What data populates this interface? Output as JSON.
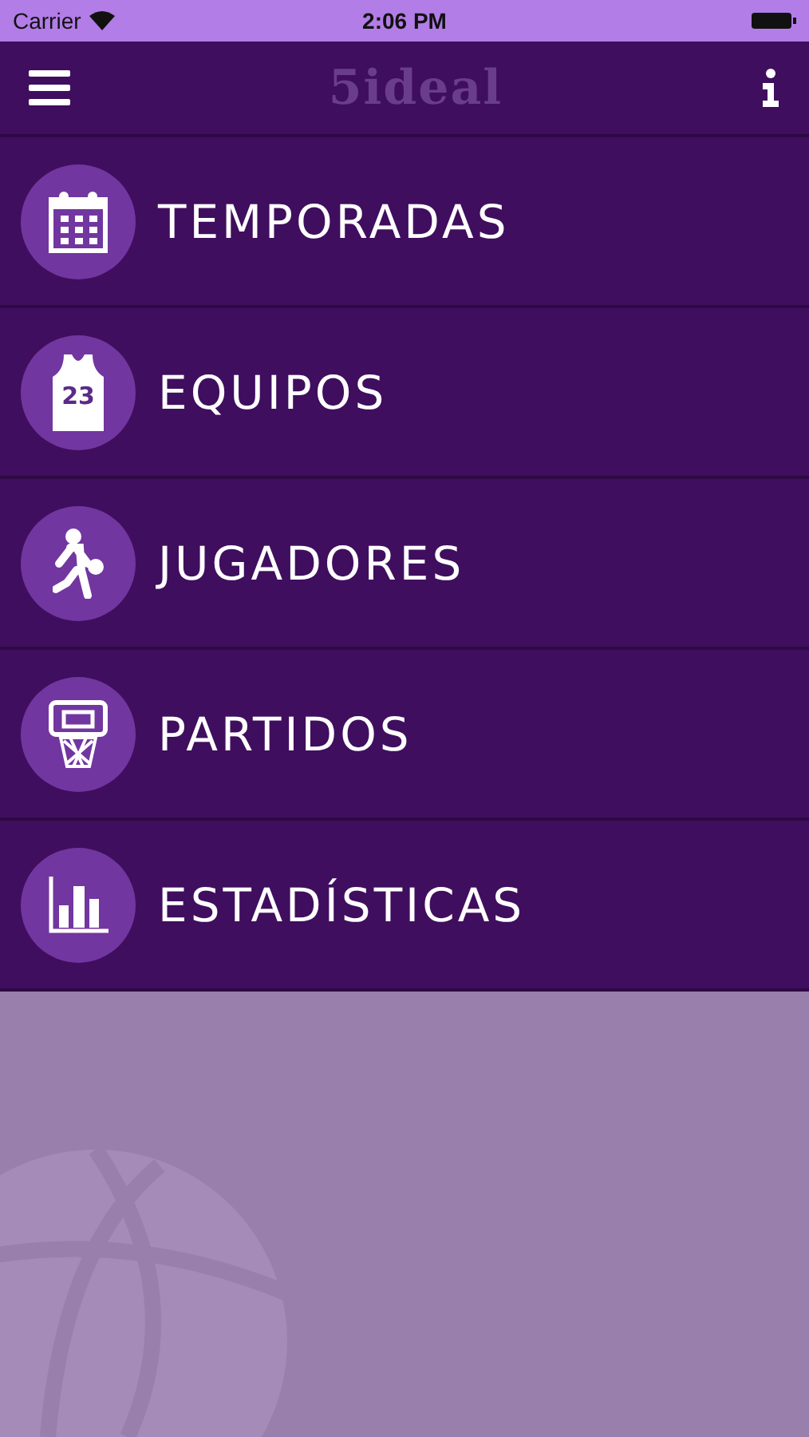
{
  "status_bar": {
    "carrier": "Carrier",
    "time": "2:06 PM"
  },
  "nav_bar": {
    "logo": "5ideal"
  },
  "menu": [
    {
      "kind": "calendar",
      "label": "TEMPORADAS"
    },
    {
      "kind": "jersey",
      "label": "EQUIPOS",
      "jersey_number": "23"
    },
    {
      "kind": "player",
      "label": "JUGADORES"
    },
    {
      "kind": "hoop",
      "label": "PARTIDOS"
    },
    {
      "kind": "chart",
      "label": "ESTADÍSTICAS"
    }
  ]
}
